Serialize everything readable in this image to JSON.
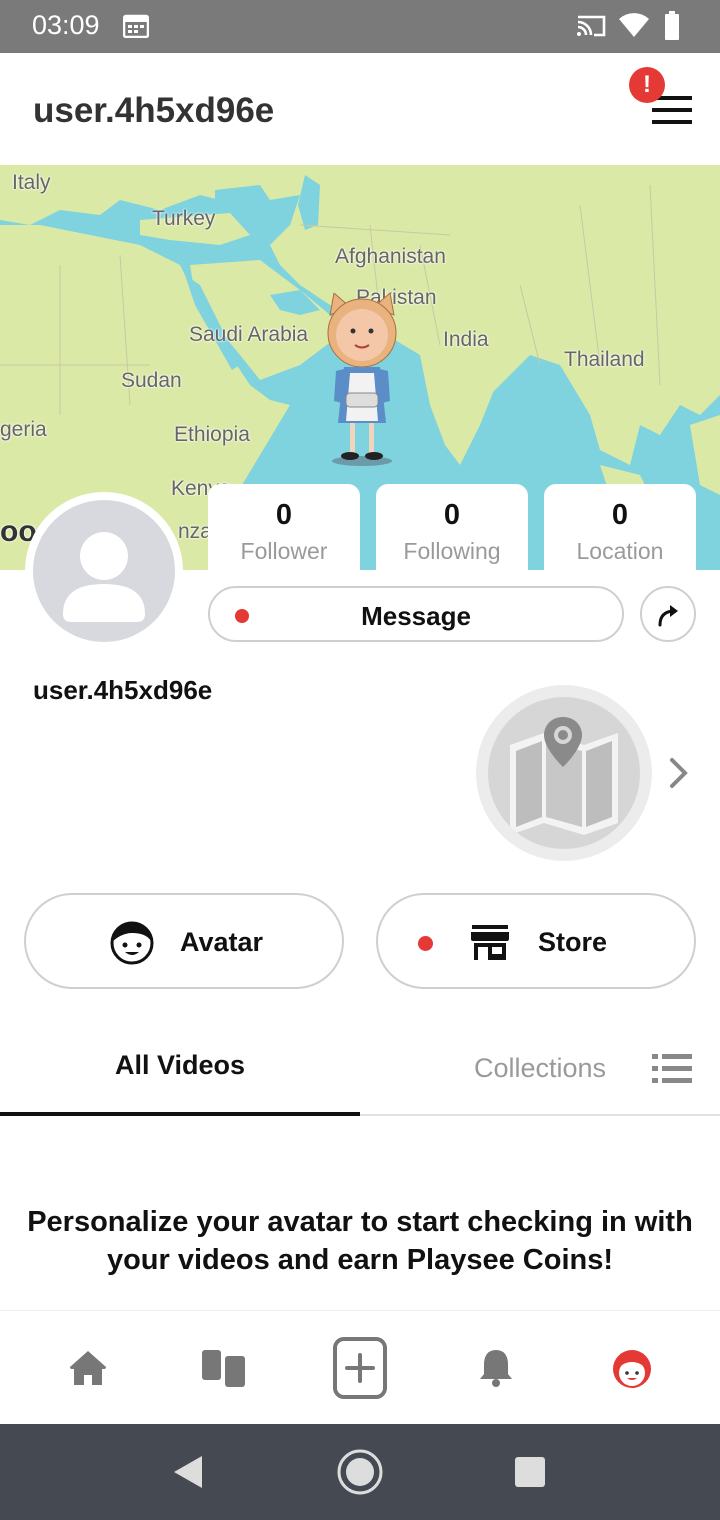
{
  "status_bar": {
    "time": "03:09",
    "icons": [
      "calendar-icon",
      "cast-icon",
      "wifi-icon",
      "battery-icon"
    ]
  },
  "header": {
    "username": "user.4h5xd96e",
    "alert_badge": "!",
    "menu_icon": "hamburger-menu-icon"
  },
  "map": {
    "labels": [
      "Italy",
      "Turkey",
      "Afghanistan",
      "Pakistan",
      "Saudi Arabia",
      "India",
      "Thailand",
      "Sudan",
      "Ethiopia",
      "Kenya",
      "geria",
      "nza",
      "oo"
    ],
    "colors": {
      "land": "#dbe9a7",
      "water": "#7fd3de"
    }
  },
  "stats": [
    {
      "value": "0",
      "label": "Follower"
    },
    {
      "value": "0",
      "label": "Following"
    },
    {
      "value": "0",
      "label": "Location"
    }
  ],
  "actions": {
    "message_label": "Message",
    "share_icon": "share-arrow-icon"
  },
  "profile": {
    "display_name": "user.4h5xd96e"
  },
  "buttons": {
    "avatar_label": "Avatar",
    "store_label": "Store"
  },
  "tabs": {
    "active": "All Videos",
    "inactive": "Collections"
  },
  "promo_text": "Personalize your avatar to start checking in with your videos and earn Playsee Coins!",
  "bottom_nav": [
    "home-icon",
    "feed-icon",
    "create-icon",
    "notifications-icon",
    "profile-icon"
  ],
  "colors": {
    "accent": "#e53935",
    "border": "#cfcfcf",
    "muted_text": "#9a9a9a"
  }
}
